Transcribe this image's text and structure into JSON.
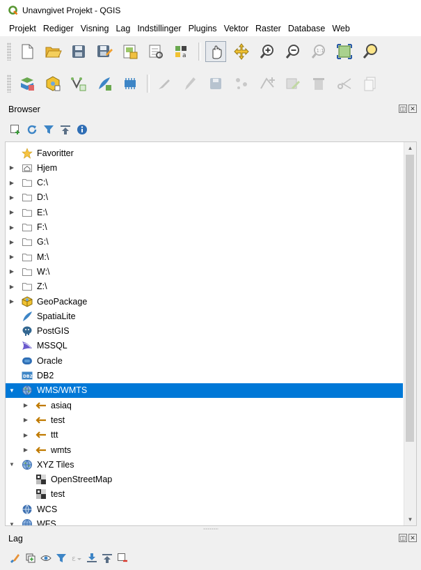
{
  "window": {
    "title": "Unavngivet Projekt - QGIS"
  },
  "menu": [
    "Projekt",
    "Rediger",
    "Visning",
    "Lag",
    "Indstillinger",
    "Plugins",
    "Vektor",
    "Raster",
    "Database",
    "Web"
  ],
  "toolbar1": [
    "new-project-icon",
    "open-project-icon",
    "save-project-icon",
    "save-as-icon",
    "new-print-layout-icon",
    "layout-manager-icon",
    "style-manager-icon",
    "pan-map-icon",
    "pan-to-selection-icon",
    "zoom-in-icon",
    "zoom-out-icon",
    "zoom-native-icon",
    "zoom-full-icon",
    "zoom-to-selection-icon"
  ],
  "toolbar2": [
    "data-source-manager-icon",
    "new-geopackage-layer-icon",
    "digitize-vertex-icon",
    "new-spatialite-layer-icon",
    "new-temporary-layer-icon",
    "current-edits-icon",
    "toggle-editing-icon",
    "save-edits-icon",
    "add-feature-icon",
    "vertex-tool-icon",
    "modify-attributes-icon",
    "delete-selected-icon",
    "cut-features-icon",
    "copy-features-icon"
  ],
  "browser": {
    "title": "Browser",
    "tools": [
      "add-selected-layers-icon",
      "refresh-icon",
      "filter-icon",
      "collapse-all-icon",
      "properties-icon"
    ],
    "items": [
      {
        "label": "Favoritter",
        "icon": "star-icon",
        "arrow": ""
      },
      {
        "label": "Hjem",
        "icon": "home-folder-icon",
        "arrow": "▶"
      },
      {
        "label": "C:\\",
        "icon": "folder-icon",
        "arrow": "▶"
      },
      {
        "label": "D:\\",
        "icon": "folder-icon",
        "arrow": "▶"
      },
      {
        "label": "E:\\",
        "icon": "folder-icon",
        "arrow": "▶"
      },
      {
        "label": "F:\\",
        "icon": "folder-icon",
        "arrow": "▶"
      },
      {
        "label": "G:\\",
        "icon": "folder-icon",
        "arrow": "▶"
      },
      {
        "label": "M:\\",
        "icon": "folder-icon",
        "arrow": "▶"
      },
      {
        "label": "W:\\",
        "icon": "folder-icon",
        "arrow": "▶"
      },
      {
        "label": "Z:\\",
        "icon": "folder-icon",
        "arrow": "▶"
      },
      {
        "label": "GeoPackage",
        "icon": "geopackage-icon",
        "arrow": "▶"
      },
      {
        "label": "SpatiaLite",
        "icon": "spatialite-icon",
        "arrow": ""
      },
      {
        "label": "PostGIS",
        "icon": "postgis-icon",
        "arrow": ""
      },
      {
        "label": "MSSQL",
        "icon": "mssql-icon",
        "arrow": ""
      },
      {
        "label": "Oracle",
        "icon": "oracle-icon",
        "arrow": ""
      },
      {
        "label": "DB2",
        "icon": "db2-icon",
        "arrow": ""
      },
      {
        "label": "WMS/WMTS",
        "icon": "wms-globe-icon",
        "arrow": "▼",
        "selected": true
      },
      {
        "label": "asiaq",
        "icon": "connection-icon",
        "arrow": "▶",
        "indent": 1
      },
      {
        "label": "test",
        "icon": "connection-icon",
        "arrow": "▶",
        "indent": 1
      },
      {
        "label": "ttt",
        "icon": "connection-icon",
        "arrow": "▶",
        "indent": 1
      },
      {
        "label": "wmts",
        "icon": "connection-icon",
        "arrow": "▶",
        "indent": 1
      },
      {
        "label": "XYZ Tiles",
        "icon": "xyz-globe-icon",
        "arrow": "▼"
      },
      {
        "label": "OpenStreetMap",
        "icon": "xyz-tile-icon",
        "arrow": "",
        "indent": 1
      },
      {
        "label": "test",
        "icon": "xyz-tile-icon",
        "arrow": "",
        "indent": 1
      },
      {
        "label": "WCS",
        "icon": "wcs-globe-icon",
        "arrow": ""
      },
      {
        "label": "WFS",
        "icon": "wfs-globe-icon",
        "arrow": "▼"
      }
    ]
  },
  "layers": {
    "title": "Lag",
    "tools": [
      "style-panel-icon",
      "add-group-icon",
      "manage-visibility-icon",
      "filter-legend-icon",
      "filter-expression-icon",
      "expand-all-icon",
      "collapse-all-icon",
      "remove-layer-icon"
    ]
  },
  "colors": {
    "selection": "#0078d7",
    "panel_bg": "#f0f0f0",
    "qgis_green": "#589632"
  }
}
